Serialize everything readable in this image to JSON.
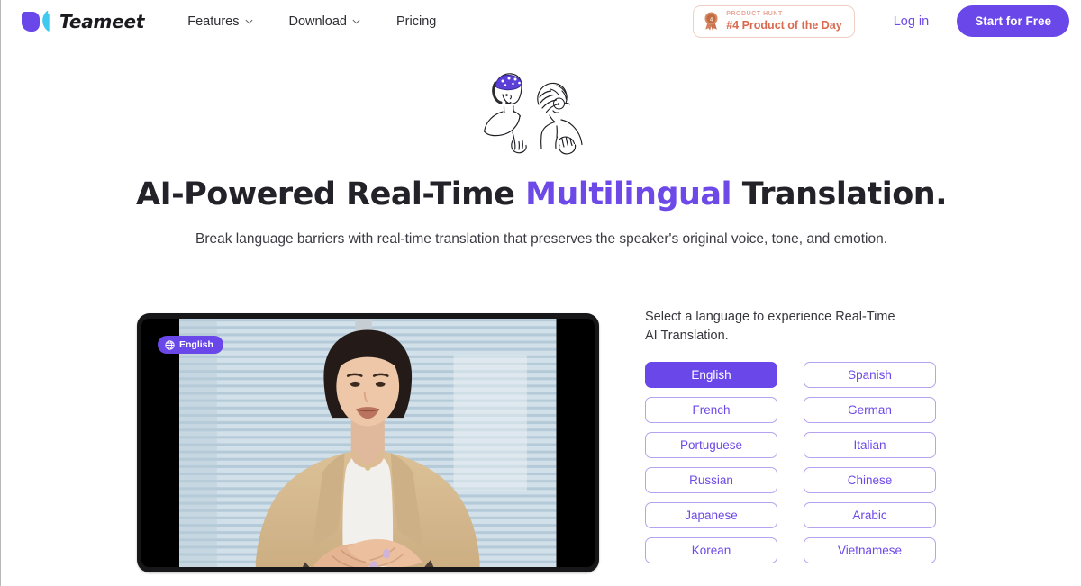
{
  "header": {
    "brand": {
      "name": "Teameet",
      "logo_icon": "teameet-logo-icon"
    },
    "nav": [
      {
        "label": "Features",
        "has_dropdown": true,
        "icon": "chevron-down-icon"
      },
      {
        "label": "Download",
        "has_dropdown": true,
        "icon": "chevron-down-icon"
      },
      {
        "label": "Pricing",
        "has_dropdown": false
      }
    ],
    "product_hunt_badge": {
      "kicker": "PRODUCT HUNT",
      "title": "#4 Product of the Day",
      "icon": "medal-icon",
      "rank": "4"
    },
    "login_label": "Log in",
    "cta_label": "Start for Free"
  },
  "hero": {
    "illustration_icon": "two-people-talking-illustration",
    "headline_part1": "AI-Powered Real-Time ",
    "headline_accent": "Multilingual",
    "headline_part2": " Translation.",
    "subheadline": "Break language barriers with real-time translation that preserves the speaker's original voice, tone, and emotion."
  },
  "video": {
    "badge_label": "English",
    "badge_icon": "globe-icon",
    "description": "video of a woman in a tan blazer speaking in front of window blinds"
  },
  "selector": {
    "label": "Select a language to experience Real-Time AI Translation.",
    "selected": "English",
    "languages": [
      "English",
      "Spanish",
      "French",
      "German",
      "Portuguese",
      "Italian",
      "Russian",
      "Chinese",
      "Japanese",
      "Arabic",
      "Korean",
      "Vietnamese"
    ]
  },
  "colors": {
    "accent": "#6a47e8",
    "accent_text": "#6d49e8",
    "accent_border": "#b5a3f0",
    "badge_text": "#d96a50",
    "badge_border": "#f0cfc4",
    "logo_cyan": "#3fc8f0",
    "text_primary": "#222228"
  }
}
